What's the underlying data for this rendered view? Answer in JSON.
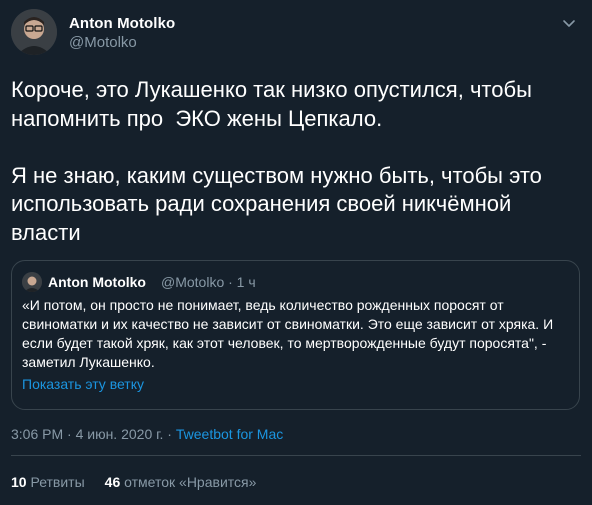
{
  "author": {
    "name": "Anton Motolko",
    "handle": "@Motolko"
  },
  "tweet_text": "Короче, это Лукашенко так низко опустился, чтобы напомнить про  ЭКО жены Цепкало.\n\nЯ не знаю, каким существом нужно быть, чтобы это использовать ради сохранения своей никчёмной власти",
  "quoted": {
    "name": "Anton Motolko",
    "meta": "@Motolko · 1 ч",
    "text": "«И потом, он просто не понимает, ведь количество рожденных поросят от свиноматки и их качество не зависит от свиноматки. Это еще зависит от хряка. И если будет такой хряк, как этот человек, то мертворожденные будут поросята\", - заметил Лукашенко.",
    "show_thread": "Показать эту ветку"
  },
  "timestamp": "3:06 PM · 4 июн. 2020 г. · ",
  "source_app": "Tweetbot for Mac",
  "stats": {
    "retweets_count": "10",
    "retweets_label": "Ретвиты",
    "likes_count": "46",
    "likes_label": "отметок «Нравится»"
  },
  "colors": {
    "background": "#15202b",
    "text": "#ffffff",
    "secondary": "#8899a6",
    "link": "#1b95e0",
    "border": "#38444d"
  },
  "icons": {
    "caret": "chevron-down-icon"
  }
}
